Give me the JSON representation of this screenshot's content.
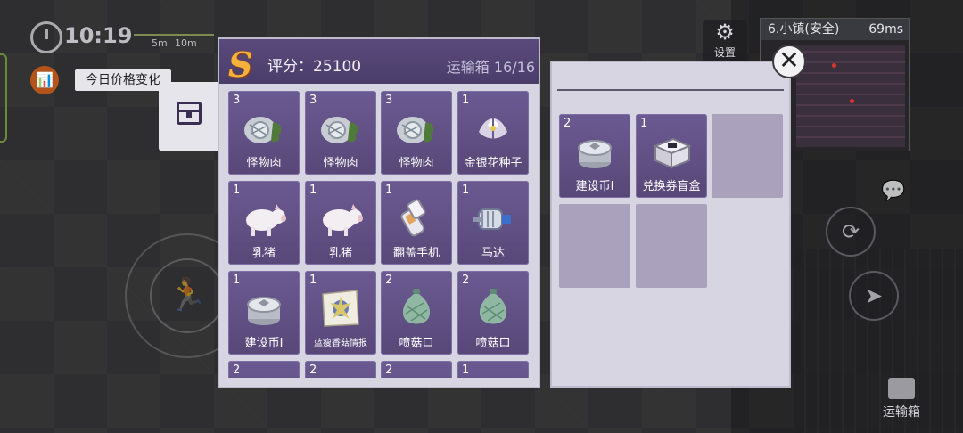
{
  "hud": {
    "time": "10:19",
    "range_near": "5m",
    "range_far": "10m",
    "price_change_label": "今日价格变化",
    "settings_label": "设置",
    "location": "6.小镇(安全)",
    "ping": "69ms",
    "transport_label": "运输箱"
  },
  "inventory": {
    "rank": "S",
    "score_label": "评分：25100",
    "box_label": "运输箱 16/16",
    "items": [
      {
        "qty": "3",
        "name": "怪物肉",
        "icon": "monster-meat-icon"
      },
      {
        "qty": "3",
        "name": "怪物肉",
        "icon": "monster-meat-icon"
      },
      {
        "qty": "3",
        "name": "怪物肉",
        "icon": "monster-meat-icon"
      },
      {
        "qty": "1",
        "name": "金银花种子",
        "icon": "honeysuckle-seed-icon"
      },
      {
        "qty": "1",
        "name": "乳猪",
        "icon": "piglet-icon"
      },
      {
        "qty": "1",
        "name": "乳猪",
        "icon": "piglet-icon"
      },
      {
        "qty": "1",
        "name": "翻盖手机",
        "icon": "flip-phone-icon"
      },
      {
        "qty": "1",
        "name": "马达",
        "icon": "motor-icon"
      },
      {
        "qty": "1",
        "name": "建设币I",
        "icon": "construction-coin-icon"
      },
      {
        "qty": "1",
        "name": "蓝瘦香菇情报",
        "icon": "intel-map-icon"
      },
      {
        "qty": "2",
        "name": "喷菇口",
        "icon": "spore-sac-icon"
      },
      {
        "qty": "2",
        "name": "喷菇口",
        "icon": "spore-sac-icon"
      },
      {
        "qty": "2",
        "name": "",
        "icon": "unknown-item-icon"
      },
      {
        "qty": "2",
        "name": "",
        "icon": "unknown-item-icon"
      },
      {
        "qty": "2",
        "name": "",
        "icon": "unknown-item-icon"
      },
      {
        "qty": "1",
        "name": "",
        "icon": "unknown-item-icon"
      }
    ]
  },
  "box": {
    "items": [
      {
        "qty": "2",
        "name": "建设币I",
        "icon": "construction-coin-icon"
      },
      {
        "qty": "1",
        "name": "兑换券盲盒",
        "icon": "voucher-box-icon"
      }
    ],
    "empty_slots": 3
  },
  "colors": {
    "slot_purple": "#5f4f84",
    "panel_bg": "#d7d5e2",
    "empty_slot": "#aaa1bd",
    "rank_gold": "#f4b23c"
  }
}
